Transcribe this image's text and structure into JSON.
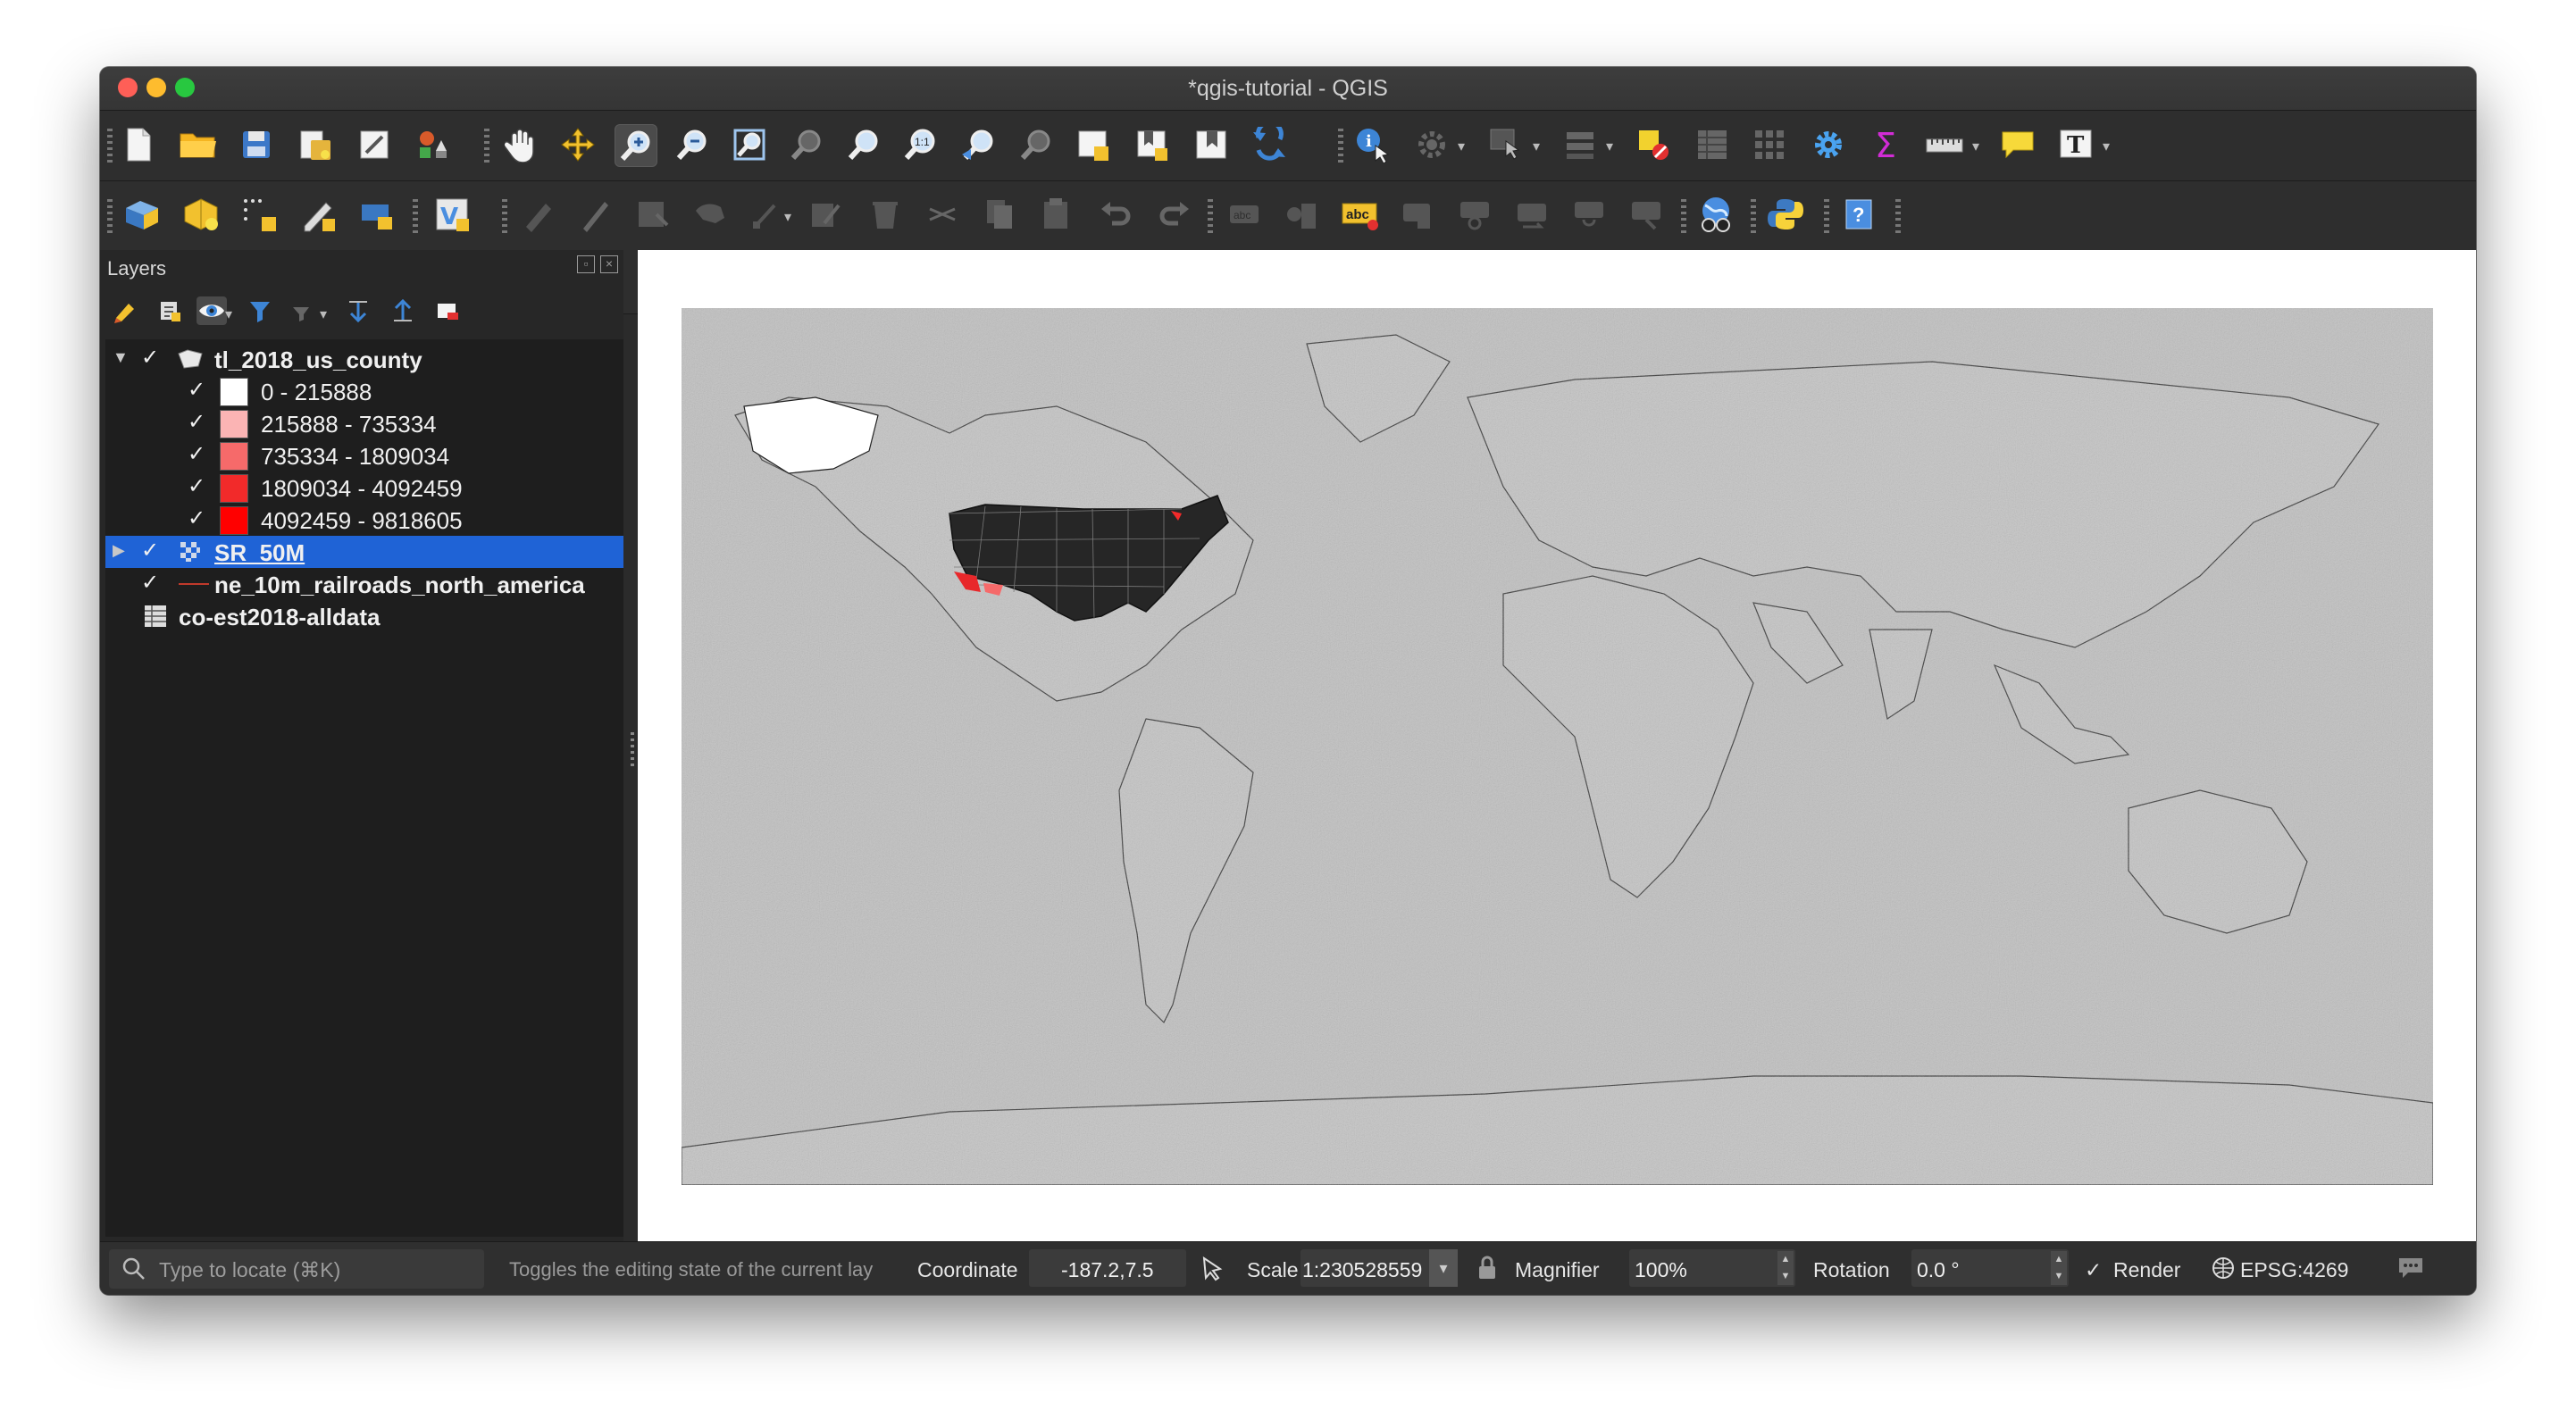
{
  "window": {
    "title": "*qgis-tutorial - QGIS"
  },
  "toolbar_primary": {
    "icons": [
      "new-project-icon",
      "open-project-icon",
      "save-project-icon",
      "save-as-icon",
      "print-layout-icon",
      "style-manager-icon",
      "pan-icon",
      "pan-to-selection-icon",
      "zoom-in-icon",
      "zoom-out-icon",
      "zoom-full-icon",
      "zoom-to-selection-icon",
      "zoom-to-layer-icon",
      "zoom-native-icon",
      "zoom-last-icon",
      "zoom-next-icon",
      "new-map-view-icon",
      "new-bookmark-icon",
      "show-bookmarks-icon",
      "refresh-icon",
      "identify-icon",
      "run-feature-action-icon",
      "select-features-icon",
      "select-by-value-icon",
      "deselect-icon",
      "attribute-table-icon",
      "field-calculator-icon",
      "settings-icon",
      "statistics-icon",
      "measure-icon",
      "map-tips-icon",
      "text-annotation-icon"
    ]
  },
  "toolbar_secondary": {
    "icons": [
      "data-source-manager-icon",
      "new-geopackage-icon",
      "new-temporary-layer-icon",
      "digitize-icon",
      "add-layer-icon",
      "add-virtual-layer-icon",
      "current-edits-icon",
      "toggle-editing-icon",
      "save-edits-icon",
      "add-feature-icon",
      "vertex-tool-icon",
      "modify-attributes-icon",
      "delete-selected-icon",
      "cut-features-icon",
      "copy-features-icon",
      "paste-features-icon",
      "undo-icon",
      "redo-icon",
      "label-tool-icon",
      "layer-labeling-icon",
      "pin-labels-icon",
      "highlight-labels-icon",
      "move-label-icon",
      "rotate-label-icon",
      "change-label-icon",
      "label-toggle-icon",
      "plugin-globe-icon",
      "python-console-icon",
      "help-icon"
    ]
  },
  "layers_panel": {
    "title": "Layers",
    "layers": [
      {
        "name": "tl_2018_us_county",
        "checked": "✓",
        "expanded": true,
        "type": "polygon"
      },
      {
        "name": "0 - 215888",
        "checked": "✓",
        "color": "#ffffff"
      },
      {
        "name": "215888 - 735334",
        "checked": "✓",
        "color": "#fbb4b4"
      },
      {
        "name": "735334 - 1809034",
        "checked": "✓",
        "color": "#f66a6a"
      },
      {
        "name": "1809034 - 4092459",
        "checked": "✓",
        "color": "#f22a2a"
      },
      {
        "name": "4092459 - 9818605",
        "checked": "✓",
        "color": "#ff0000"
      },
      {
        "name": "SR_50M",
        "checked": "✓",
        "selected": true,
        "type": "raster"
      },
      {
        "name": "ne_10m_railroads_north_america",
        "checked": "✓",
        "type": "line"
      },
      {
        "name": "co-est2018-alldata",
        "type": "table"
      }
    ]
  },
  "statusbar": {
    "locator_placeholder": "Type to locate (⌘K)",
    "message": "Toggles the editing state of the current lay",
    "coordinate_label": "Coordinate",
    "coordinate_value": "-187.2,7.5",
    "scale_label": "Scale",
    "scale_value": "1:230528559",
    "magnifier_label": "Magnifier",
    "magnifier_value": "100%",
    "rotation_label": "Rotation",
    "rotation_value": "0.0 °",
    "render_label": "Render",
    "render_checked": "✓",
    "crs": "EPSG:4269"
  },
  "colors": {
    "selection": "#1f63d6",
    "map_background": "#c0c0c0",
    "county_fill": "#2a2a2a",
    "highlight_red": "#e8282b"
  }
}
